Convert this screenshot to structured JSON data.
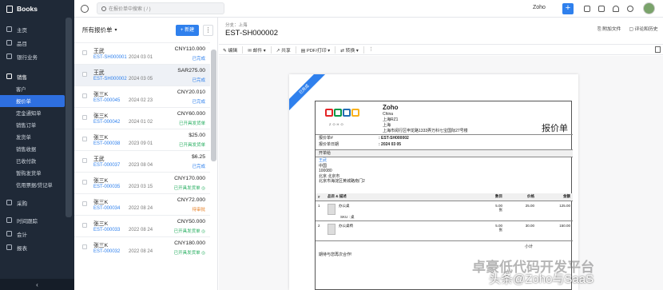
{
  "app": {
    "name": "Books"
  },
  "sidebar": {
    "items": [
      {
        "label": "主页"
      },
      {
        "label": "品目"
      },
      {
        "label": "银行业务"
      }
    ],
    "sales_label": "销售",
    "subitems": [
      {
        "label": "客户"
      },
      {
        "label": "报价单"
      },
      {
        "label": "定金通知单"
      },
      {
        "label": "销售订单"
      },
      {
        "label": "发货单"
      },
      {
        "label": "销售收据"
      },
      {
        "label": "已收付款"
      },
      {
        "label": "暂购发货单"
      },
      {
        "label": "信用票据/贷记单"
      }
    ],
    "lower": [
      {
        "label": "采购"
      },
      {
        "label": "时间跟踪"
      },
      {
        "label": "会计"
      },
      {
        "label": "报表"
      }
    ]
  },
  "topbar": {
    "search_placeholder": "在报价单中搜索 ( / )",
    "org": "Zoho",
    "plus": "+"
  },
  "list": {
    "title": "所有报价单",
    "new_button": "+ 新建",
    "more": "⋮",
    "rows": [
      {
        "name": "王武",
        "num": "EST-SH000001",
        "date": "2024 03 01",
        "amount": "CNY110.000",
        "status": "已完成",
        "color": "#2f80ed"
      },
      {
        "name": "王武",
        "num": "EST-SH000002",
        "date": "2024 03 05",
        "amount": "SAR275.00",
        "status": "已完成",
        "color": "#2f80ed"
      },
      {
        "name": "张三K",
        "num": "EST-000045",
        "date": "2024 02 23",
        "amount": "CNY20.010",
        "status": "已完成",
        "color": "#2f80ed"
      },
      {
        "name": "张三K",
        "num": "EST-000042",
        "date": "2024 01 02",
        "amount": "CNY60.000",
        "status": "已开具发货单",
        "color": "#27ae60"
      },
      {
        "name": "张三K",
        "num": "EST-000038",
        "date": "2023 09 01",
        "amount": "$25.00",
        "status": "已开具发货单",
        "color": "#27ae60"
      },
      {
        "name": "王武",
        "num": "EST-000037",
        "date": "2023 08 04",
        "amount": "$6.25",
        "status": "已完成",
        "color": "#2f80ed"
      },
      {
        "name": "张三K",
        "num": "EST-000035",
        "date": "2023 03 15",
        "amount": "CNY170.000",
        "status": "已开具发货单 ◎",
        "color": "#27ae60"
      },
      {
        "name": "张三K",
        "num": "EST-000034",
        "date": "2022 08 24",
        "amount": "CNY72.000",
        "status": "待审批",
        "color": "#e67e22"
      },
      {
        "name": "张三K",
        "num": "EST-000033",
        "date": "2022 08 24",
        "amount": "CNY50.000",
        "status": "已开具发货单 ◎",
        "color": "#27ae60"
      },
      {
        "name": "张三K",
        "num": "EST-000032",
        "date": "2022 08 24",
        "amount": "CNY180.000",
        "status": "已开具发货单 ◎",
        "color": "#27ae60"
      }
    ]
  },
  "detail": {
    "breadcrumb": "分支：上海",
    "title": "EST-SH000002",
    "attach": "附加文件",
    "comments": "评论和历史",
    "toolbar": {
      "edit": "编辑",
      "mail": "邮件 ▾",
      "share": "共享",
      "pdf": "PDF/打印 ▾",
      "convert": "转换 ▾",
      "more": "⋮"
    }
  },
  "document": {
    "ribbon": "已完成",
    "logo_text": "ZOHO",
    "company": {
      "name": "Zoho",
      "lines": [
        "China",
        "上海RZ1",
        "上海",
        "上海市闵行区申龙路1333弄万科七宝国际27号楼"
      ]
    },
    "heading": "报价单",
    "meta": [
      {
        "label": "报价单#",
        "value": ": EST-SH000002"
      },
      {
        "label": "报价单日期",
        "value": ": 2024 03 05"
      }
    ],
    "bill_to_label": "开单给",
    "bill_to": {
      "name": "王武",
      "lines": [
        "中国",
        "100080",
        "北京 北京市",
        "北京市海淀区黄城路南门2"
      ]
    },
    "table": {
      "headers": [
        "#",
        "品目 & 描述",
        "数目",
        "价格",
        "金额"
      ],
      "items": [
        {
          "idx": "1",
          "name": "办公桌",
          "sku": "SKU : 桌",
          "qty": "5.00",
          "unit": "张",
          "price": "25.00",
          "amount": "125.00"
        },
        {
          "idx": "2",
          "name": "办公桌椅",
          "sku": "",
          "qty": "5.00",
          "unit": "张",
          "price": "30.00",
          "amount": "150.00"
        }
      ]
    },
    "subtotal_label": "小计",
    "footer_note": "期待与您再次合作!"
  },
  "watermark": {
    "line1": "卓豪低代码开发平台",
    "line2": "头条@Zoho与SaaS"
  }
}
